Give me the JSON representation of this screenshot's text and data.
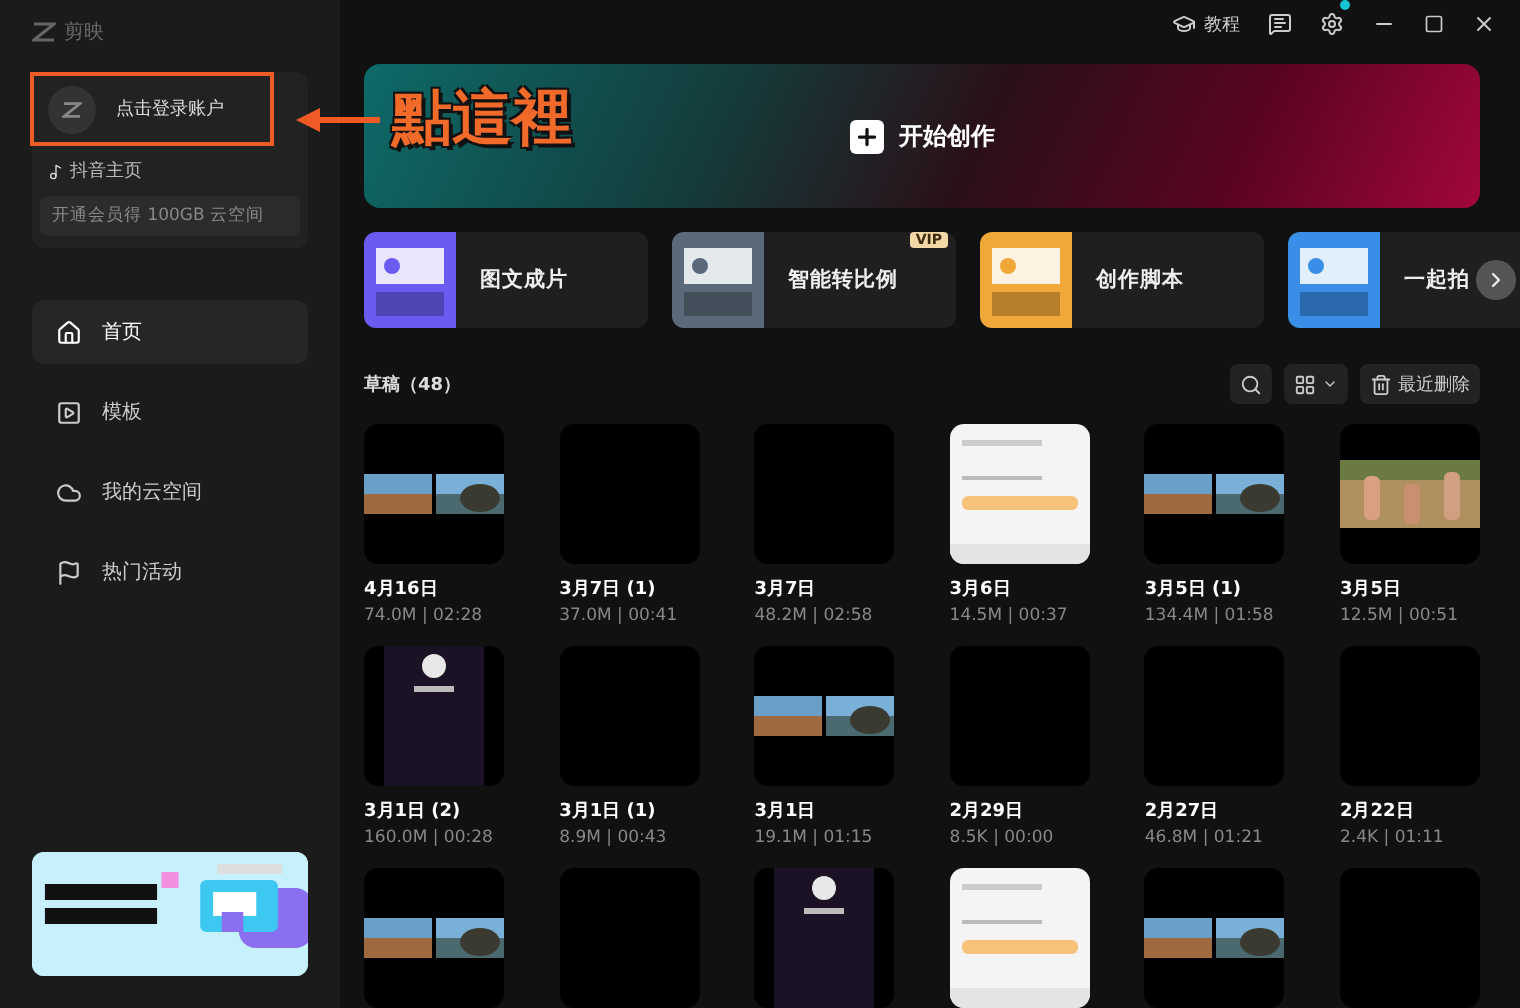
{
  "app": {
    "name": "剪映"
  },
  "account": {
    "login": "点击登录账户",
    "douyin": "抖音主页",
    "upgrade": "开通会员得 100GB 云空间"
  },
  "nav": [
    {
      "label": "首页",
      "kind": "home",
      "selected": true
    },
    {
      "label": "模板",
      "kind": "template",
      "selected": false
    },
    {
      "label": "我的云空间",
      "kind": "cloud",
      "selected": false
    },
    {
      "label": "热门活动",
      "kind": "flag",
      "selected": false
    }
  ],
  "topbar": {
    "tutorial": "教程",
    "settings_notification": true
  },
  "create": {
    "label": "开始创作"
  },
  "features": [
    {
      "title": "图文成片",
      "color": "#6a5cf0",
      "vip": false
    },
    {
      "title": "智能转比例",
      "color": "#5a6a7a",
      "vip": true
    },
    {
      "title": "创作脚本",
      "color": "#f0a838",
      "vip": false
    },
    {
      "title": "一起拍",
      "color": "#3a8ee8",
      "vip": false
    }
  ],
  "vip_label": "VIP",
  "drafts": {
    "title": "草稿（48）",
    "delete": "最近删除",
    "items": [
      {
        "kind": "picture",
        "date": "4月16日",
        "meta": "74.0M | 02:28"
      },
      {
        "kind": "blank",
        "date": "3月7日 (1)",
        "meta": "37.0M | 00:41"
      },
      {
        "kind": "blank",
        "date": "3月7日",
        "meta": "48.2M | 02:58"
      },
      {
        "kind": "picture",
        "date": "3月6日",
        "meta": "14.5M | 00:37"
      },
      {
        "kind": "picture",
        "date": "3月5日 (1)",
        "meta": "134.4M | 01:58"
      },
      {
        "kind": "picture",
        "date": "3月5日",
        "meta": "12.5M | 00:51"
      },
      {
        "kind": "picture",
        "date": "3月1日 (2)",
        "meta": "160.0M | 00:28"
      },
      {
        "kind": "blank",
        "date": "3月1日 (1)",
        "meta": "8.9M | 00:43"
      },
      {
        "kind": "picture",
        "date": "3月1日",
        "meta": "19.1M | 01:15"
      },
      {
        "kind": "blank",
        "date": "2月29日",
        "meta": "8.5K | 00:00"
      },
      {
        "kind": "blank",
        "date": "2月27日",
        "meta": "46.8M | 01:21"
      },
      {
        "kind": "blank",
        "date": "2月22日",
        "meta": "2.4K | 01:11"
      },
      {
        "kind": "picture"
      },
      {
        "kind": "blank"
      },
      {
        "kind": "picture"
      },
      {
        "kind": "picture"
      },
      {
        "kind": "picture"
      },
      {
        "kind": "blank"
      }
    ]
  },
  "annotation": {
    "text": "點這裡",
    "highlight_login": true
  }
}
